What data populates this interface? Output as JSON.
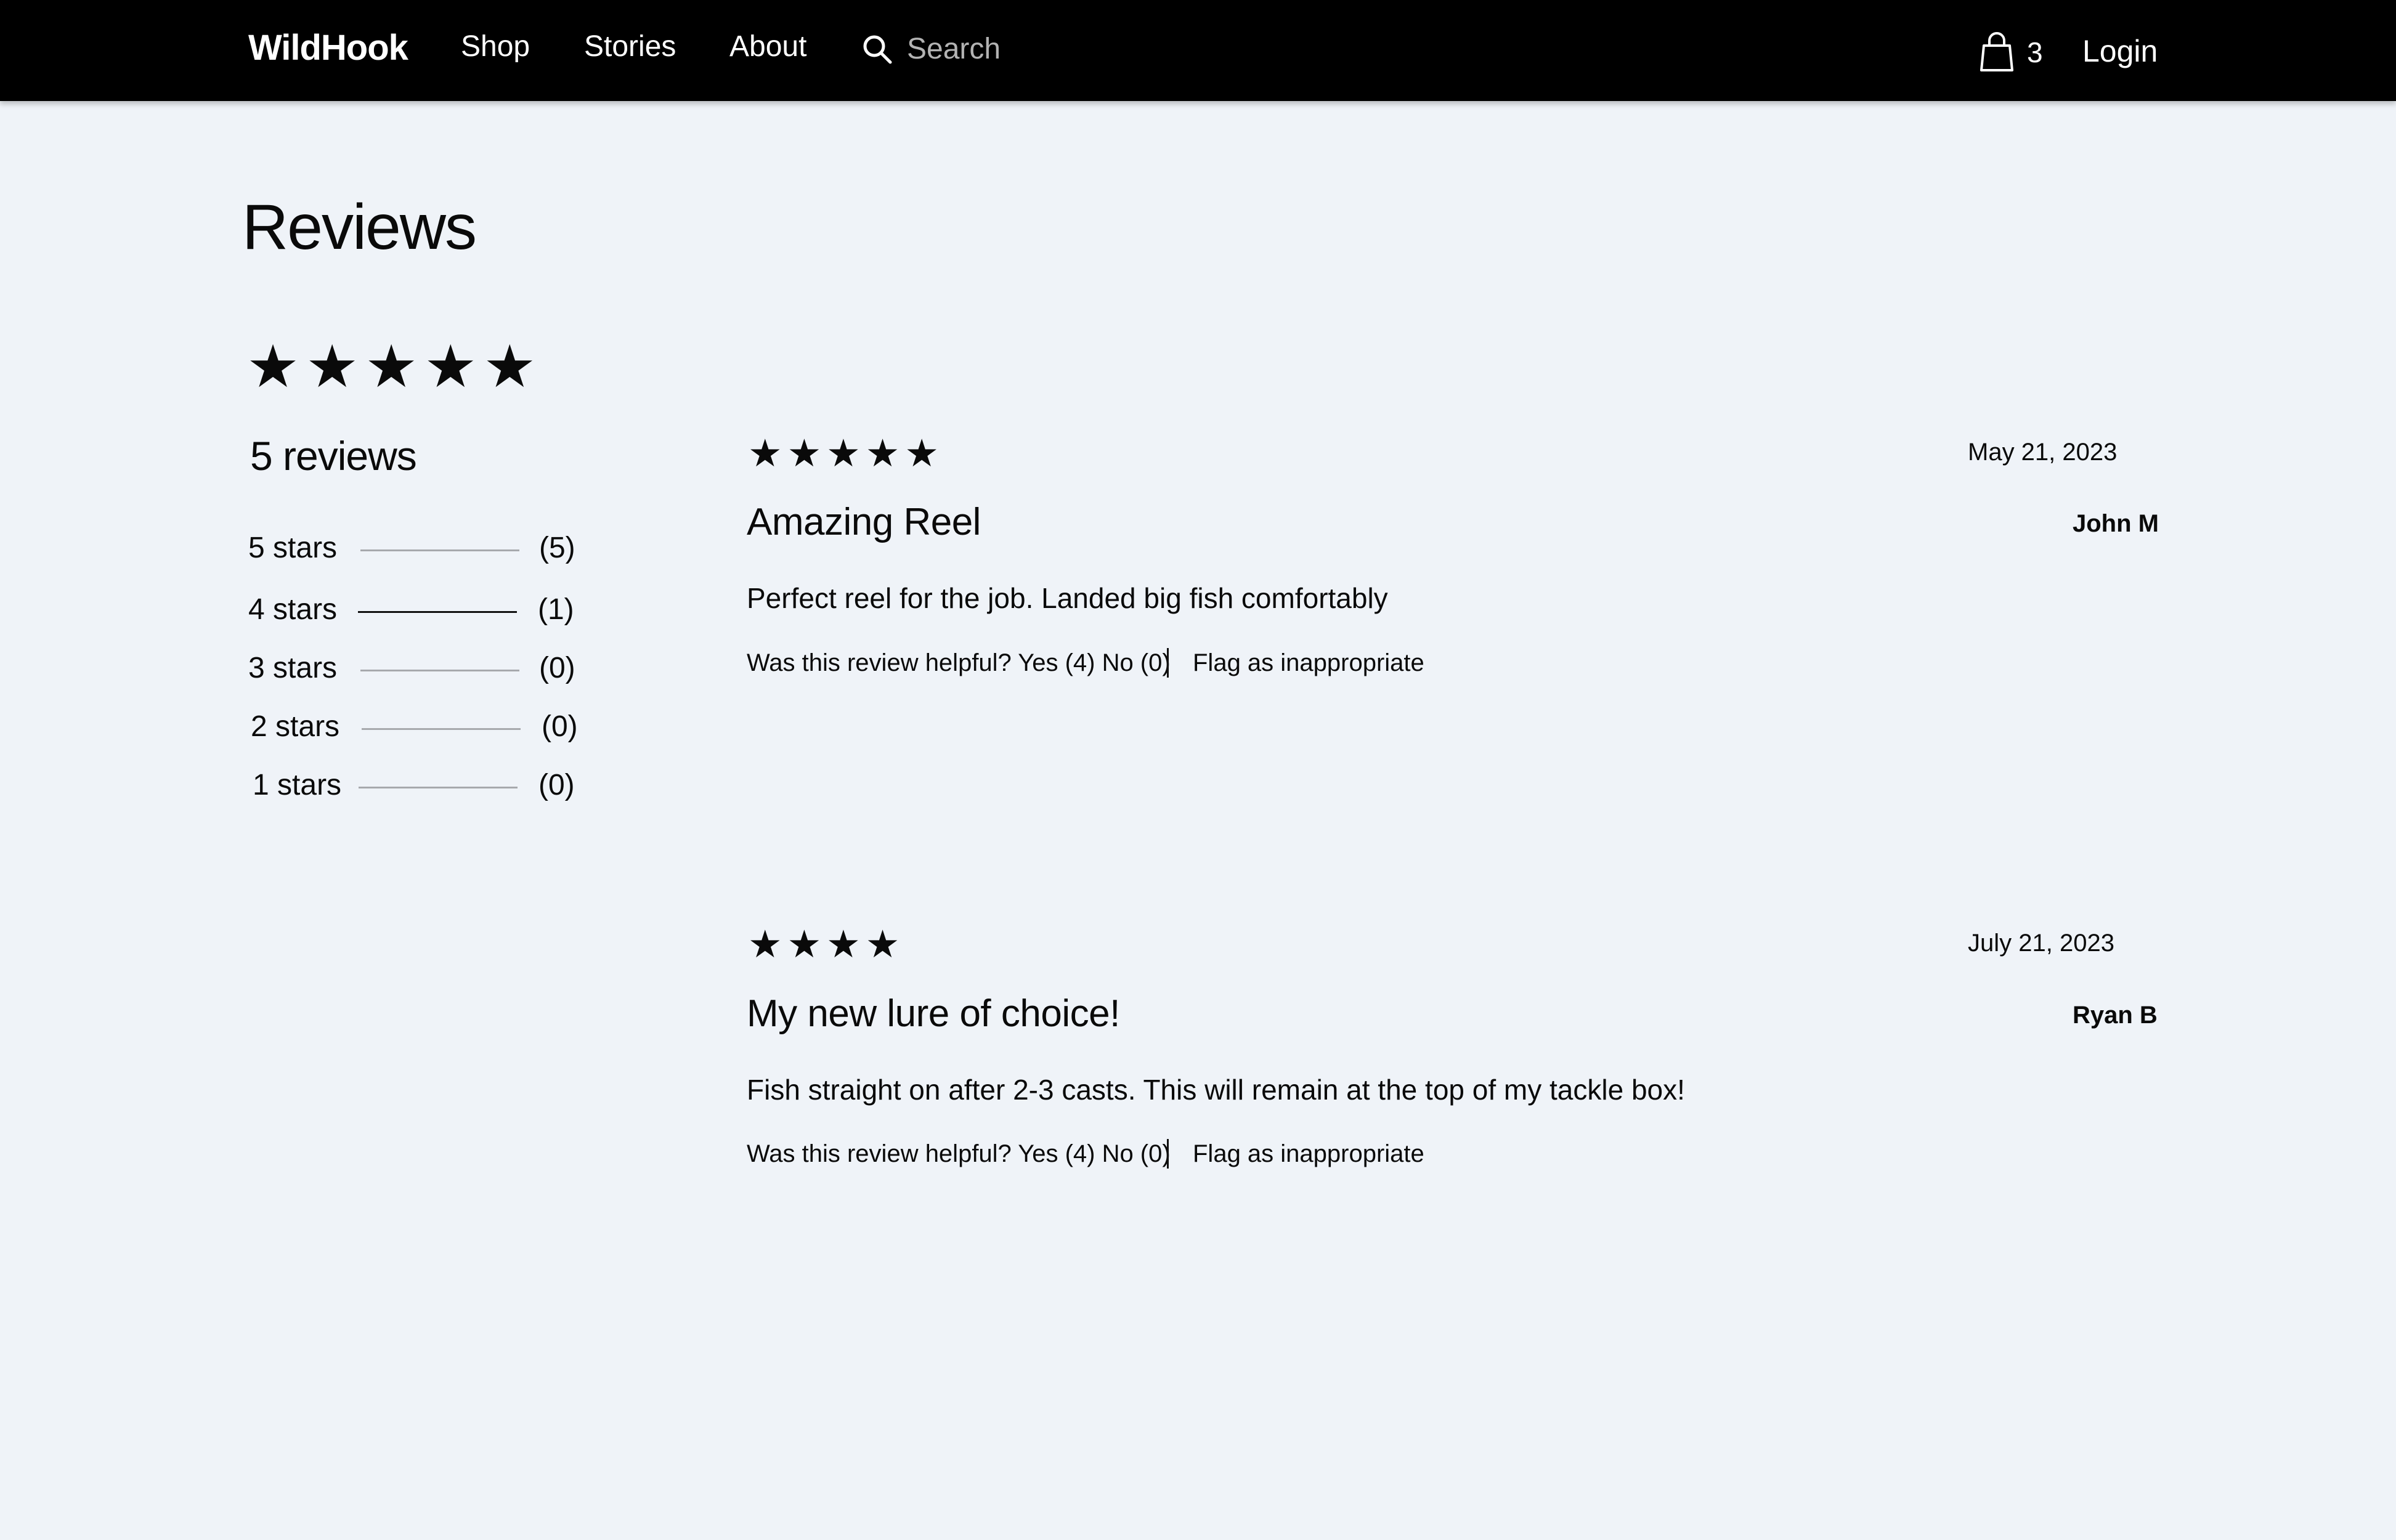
{
  "nav": {
    "brand": "WildHook",
    "links": [
      "Shop",
      "Stories",
      "About"
    ],
    "search_placeholder": "Search",
    "cart_count": "3",
    "login": "Login"
  },
  "page": {
    "title": "Reviews",
    "overall_stars": "★★★★★",
    "reviews_count": "5 reviews",
    "breakdown": [
      {
        "label": "5 stars",
        "count": "(5)",
        "fraction": 0
      },
      {
        "label": "4 stars",
        "count": "(1)",
        "fraction": 1
      },
      {
        "label": "3 stars",
        "count": "(0)",
        "fraction": 0
      },
      {
        "label": "2 stars",
        "count": "(0)",
        "fraction": 0
      },
      {
        "label": "1 stars",
        "count": "(0)",
        "fraction": 0
      }
    ]
  },
  "reviews": [
    {
      "stars": "★★★★★",
      "date": "May 21, 2023",
      "title": "Amazing Reel",
      "author": "John M",
      "body": "Perfect reel for the job. Landed big fish comfortably",
      "helpful": "Was this review helpful? Yes (4) No (0)",
      "flag": "Flag as inappropriate"
    },
    {
      "stars": "★★★★",
      "date": "July 21, 2023",
      "title": "My new lure of choice!",
      "author": "Ryan B",
      "body": "Fish straight on after 2-3 casts. This will remain at the top of my tackle box!",
      "helpful": "Was this review helpful? Yes (4) No (0)",
      "flag": "Flag as inappropriate"
    }
  ]
}
